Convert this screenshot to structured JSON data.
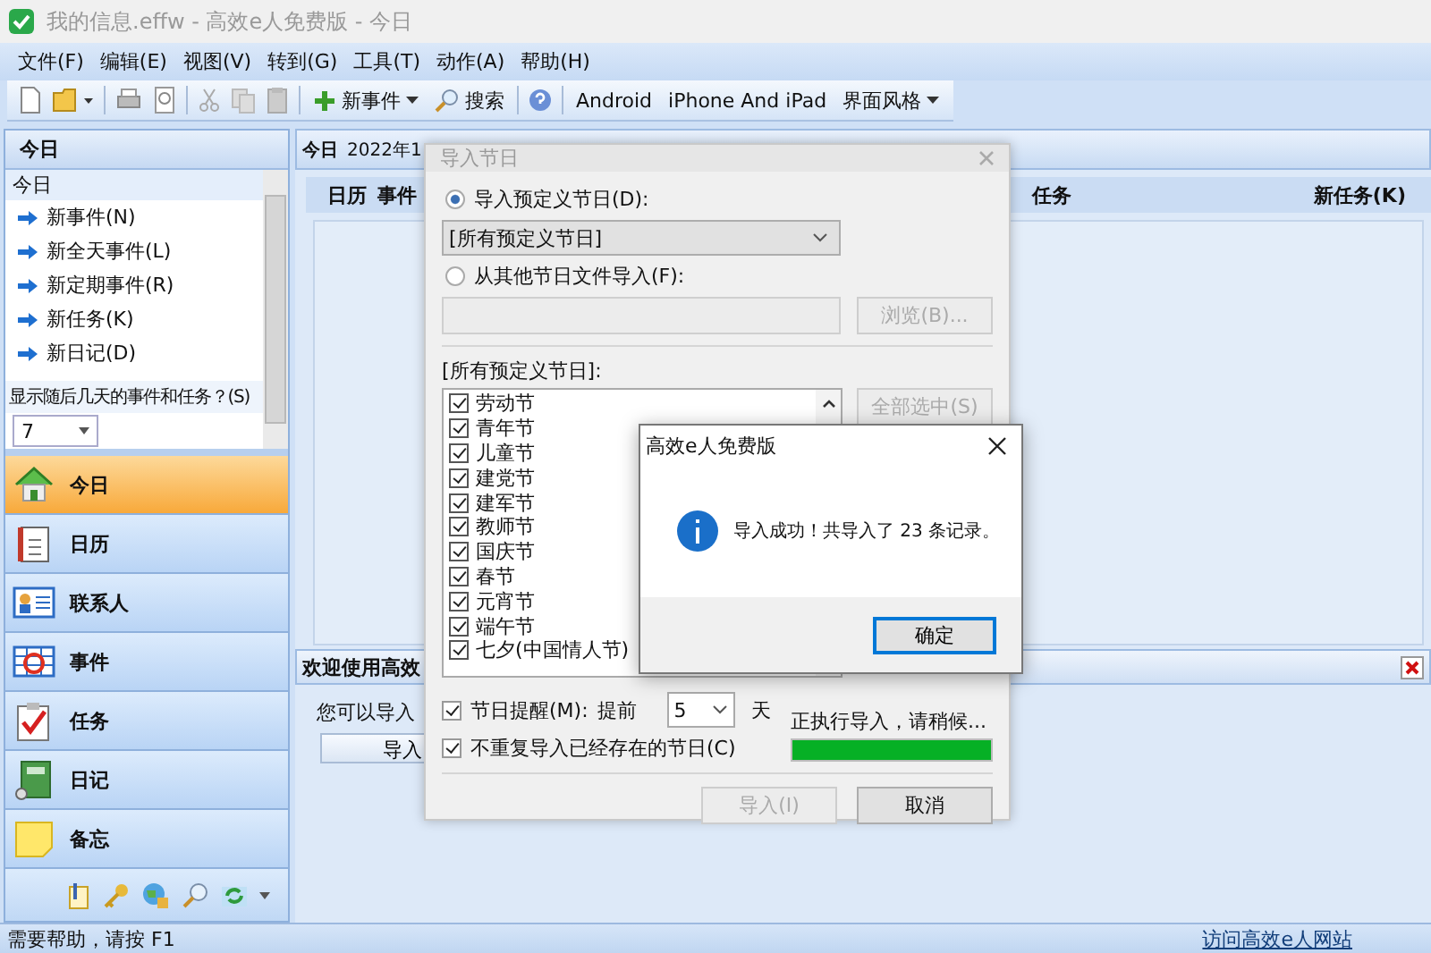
{
  "window": {
    "title": "我的信息.effw - 高效e人免费版 - 今日"
  },
  "menu": [
    "文件(F)",
    "编辑(E)",
    "视图(V)",
    "转到(G)",
    "工具(T)",
    "动作(A)",
    "帮助(H)"
  ],
  "toolbar": {
    "buttons": [
      {
        "label": "新事件",
        "kind": "add",
        "dropdown": true
      },
      {
        "label": "搜索",
        "kind": "search",
        "dropdown": false
      },
      {
        "label": "Android",
        "kind": "text",
        "dropdown": false
      },
      {
        "label": "iPhone And iPad",
        "kind": "text",
        "dropdown": false
      },
      {
        "label": "界面风格",
        "kind": "text",
        "dropdown": true
      }
    ]
  },
  "sidebar": {
    "header": "今日",
    "panel_title": "今日",
    "links": [
      "新事件(N)",
      "新全天事件(L)",
      "新定期事件(R)",
      "新任务(K)",
      "新日记(D)"
    ],
    "days_question": "显示随后几天的事件和任务？(S)",
    "days_value": "7",
    "nav": [
      {
        "label": "今日",
        "kind": "home",
        "selected": true
      },
      {
        "label": "日历",
        "kind": "calendar",
        "selected": false
      },
      {
        "label": "联系人",
        "kind": "contacts",
        "selected": false
      },
      {
        "label": "事件",
        "kind": "events",
        "selected": false
      },
      {
        "label": "任务",
        "kind": "tasks",
        "selected": false
      },
      {
        "label": "日记",
        "kind": "diary",
        "selected": false
      },
      {
        "label": "备忘",
        "kind": "memo",
        "selected": false
      }
    ]
  },
  "main": {
    "header": "今日",
    "date": "2022年1",
    "tabs": [
      "日历",
      "事件"
    ],
    "task_title": "任务",
    "new_task": "新任务(K)",
    "welcome": {
      "title": "欢迎使用高效",
      "text": "您可以导入",
      "button": "导入"
    }
  },
  "import_dialog": {
    "title": "导入节日",
    "options": [
      {
        "label": "导入预定义节日(D):",
        "selected": true
      },
      {
        "label": "从其他节日文件导入(F):",
        "selected": false
      }
    ],
    "preset_select": "[所有预定义节日]",
    "browse_button": {
      "label": "浏览(B)...",
      "disabled": true
    },
    "list_label": "[所有预定义节日]:",
    "holidays": [
      {
        "label": "劳动节",
        "checked": true
      },
      {
        "label": "青年节",
        "checked": true
      },
      {
        "label": "儿童节",
        "checked": true
      },
      {
        "label": "建党节",
        "checked": true
      },
      {
        "label": "建军节",
        "checked": true
      },
      {
        "label": "教师节",
        "checked": true
      },
      {
        "label": "国庆节",
        "checked": true
      },
      {
        "label": "春节",
        "checked": true
      },
      {
        "label": "元宵节",
        "checked": true
      },
      {
        "label": "端午节",
        "checked": true
      },
      {
        "label": "七夕(中国情人节)",
        "checked": true
      }
    ],
    "select_all_button": {
      "label": "全部选中(S)",
      "disabled": true
    },
    "reminder": {
      "label": "节日提醒(M):",
      "checked": true,
      "prefix": "提前",
      "days": "5",
      "unit": "天"
    },
    "skip_existing": {
      "label": "不重复导入已经存在的节日(C)",
      "checked": true
    },
    "progress": {
      "text": "正执行导入，请稍候...",
      "level": 1
    },
    "import_button": {
      "label": "导入(I)",
      "disabled": true
    },
    "cancel_button": {
      "label": "取消",
      "disabled": false
    }
  },
  "message_box": {
    "title": "高效e人免费版",
    "message": "导入成功！共导入了 23 条记录。",
    "ok_button": "确定"
  },
  "status_bar": {
    "help": "需要帮助，请按 F1",
    "link": "访问高效e人网站"
  }
}
